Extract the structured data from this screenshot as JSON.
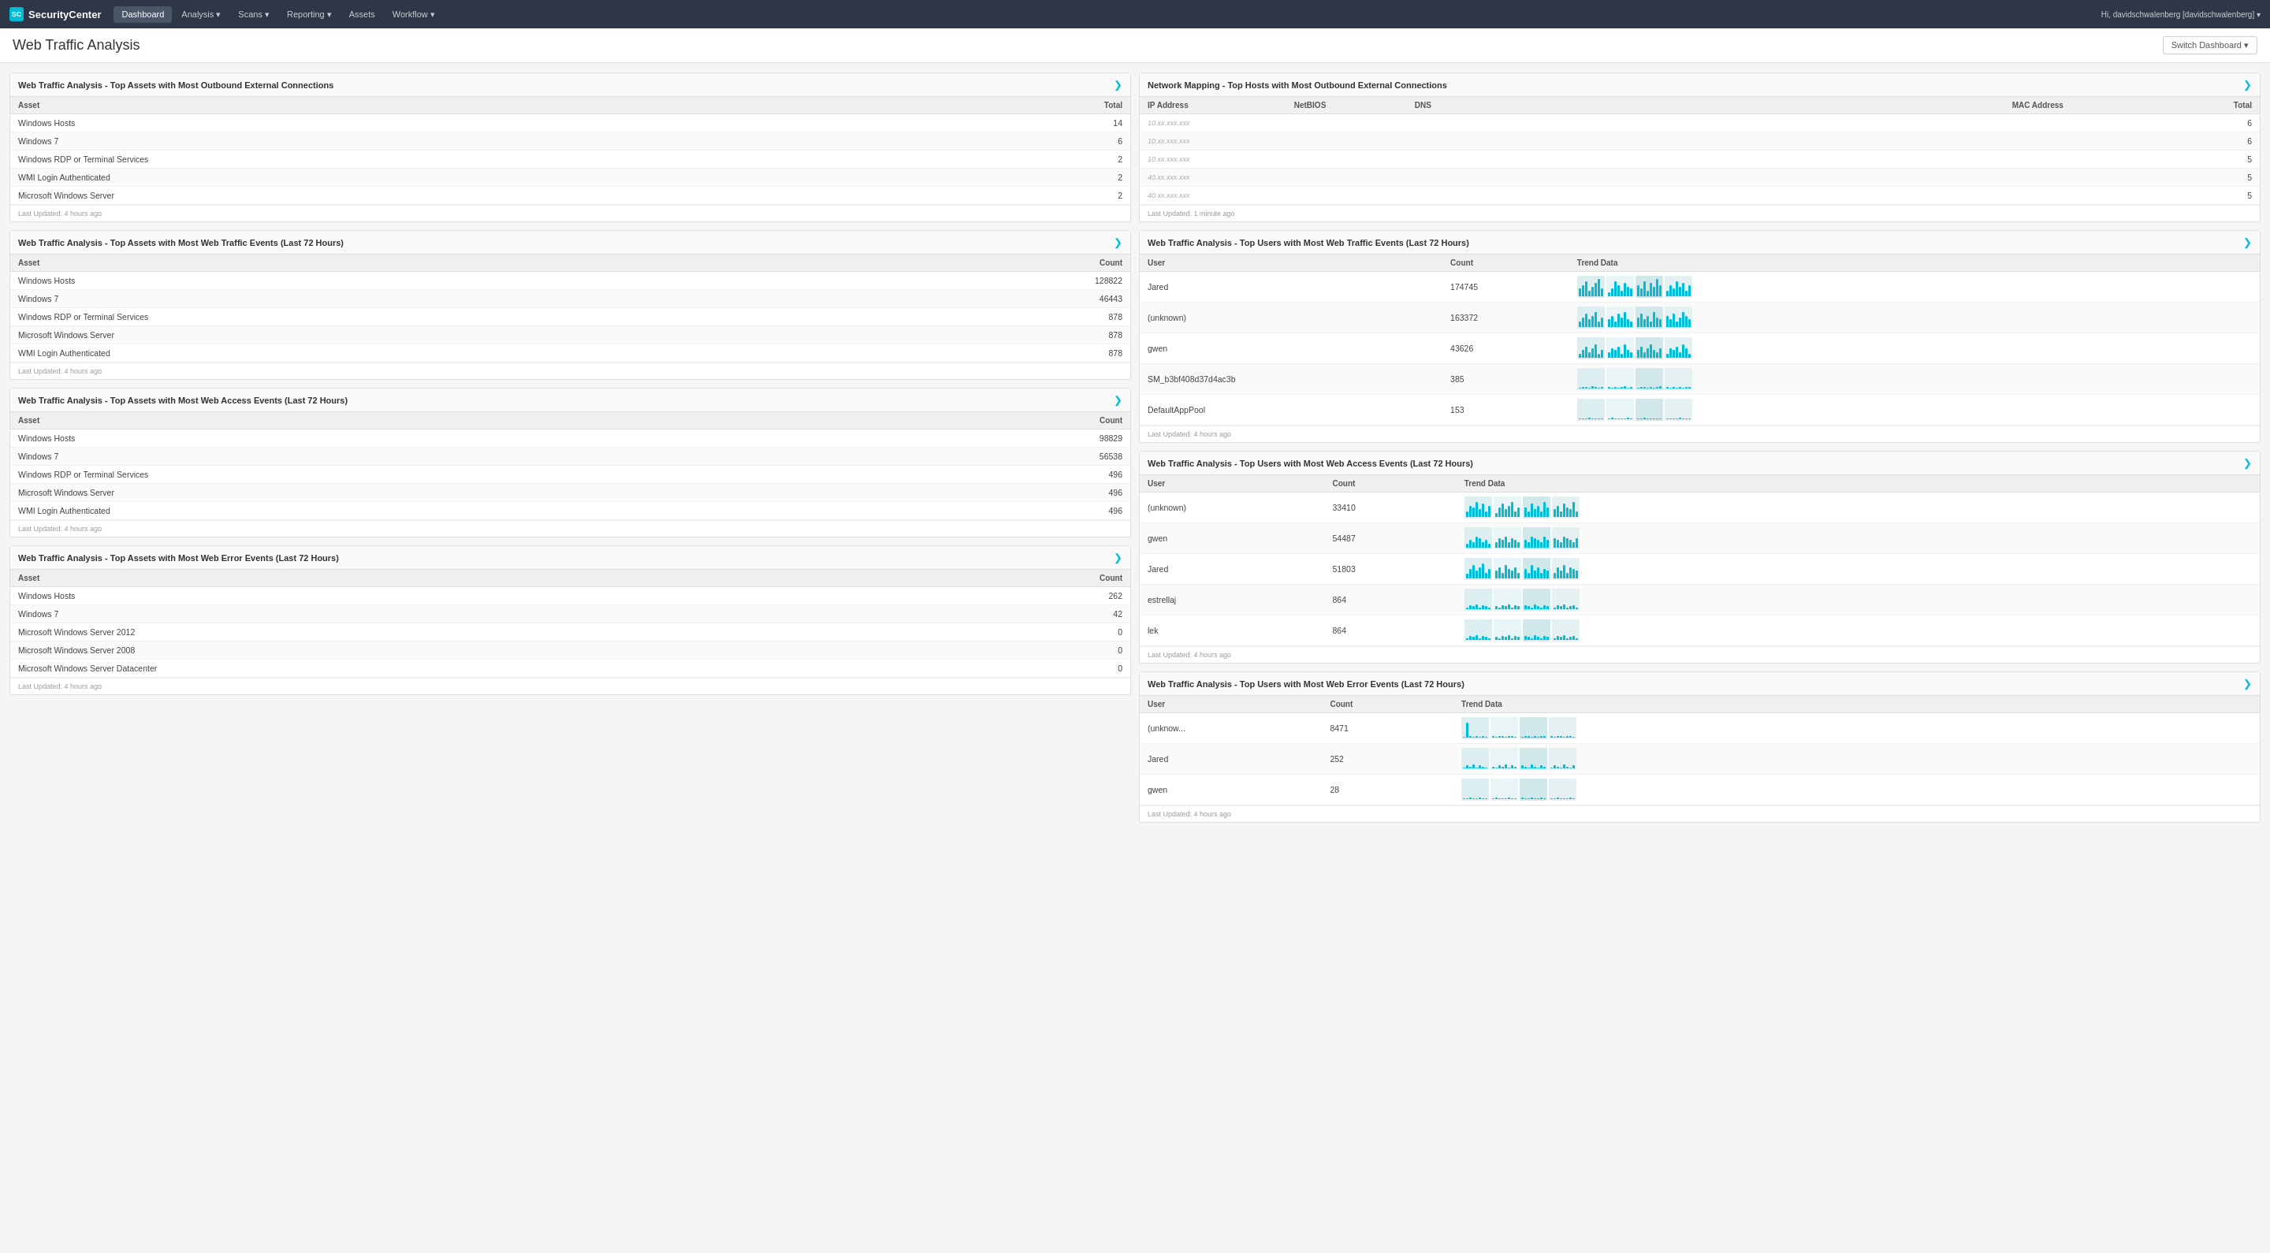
{
  "navbar": {
    "brand": "SecurityCenter",
    "logo_text": "SC",
    "links": [
      {
        "label": "Dashboard",
        "active": true,
        "has_arrow": false
      },
      {
        "label": "Analysis",
        "active": false,
        "has_arrow": true
      },
      {
        "label": "Scans",
        "active": false,
        "has_arrow": true
      },
      {
        "label": "Reporting",
        "active": false,
        "has_arrow": true
      },
      {
        "label": "Assets",
        "active": false,
        "has_arrow": false
      },
      {
        "label": "Workflow",
        "active": false,
        "has_arrow": true
      }
    ],
    "user": "Hi, davidschwalenberg [davidschwalenberg] ▾"
  },
  "page": {
    "title": "Web Traffic Analysis",
    "switch_dashboard_label": "Switch Dashboard ▾"
  },
  "panels": {
    "top_outbound": {
      "title": "Web Traffic Analysis - Top Assets with Most Outbound External Connections",
      "columns": [
        "Asset",
        "Total"
      ],
      "rows": [
        {
          "asset": "Windows Hosts",
          "value": "14"
        },
        {
          "asset": "Windows 7",
          "value": "6"
        },
        {
          "asset": "Windows RDP or Terminal Services",
          "value": "2"
        },
        {
          "asset": "WMI Login Authenticated",
          "value": "2"
        },
        {
          "asset": "Microsoft Windows Server",
          "value": "2"
        }
      ],
      "footer": "Last Updated: 4 hours ago"
    },
    "top_web_traffic": {
      "title": "Web Traffic Analysis - Top Assets with Most Web Traffic Events (Last 72 Hours)",
      "columns": [
        "Asset",
        "Count"
      ],
      "rows": [
        {
          "asset": "Windows Hosts",
          "value": "128822"
        },
        {
          "asset": "Windows 7",
          "value": "46443"
        },
        {
          "asset": "Windows RDP or Terminal Services",
          "value": "878"
        },
        {
          "asset": "Microsoft Windows Server",
          "value": "878"
        },
        {
          "asset": "WMI Login Authenticated",
          "value": "878"
        }
      ],
      "footer": "Last Updated: 4 hours ago"
    },
    "top_web_access": {
      "title": "Web Traffic Analysis - Top Assets with Most Web Access Events (Last 72 Hours)",
      "columns": [
        "Asset",
        "Count"
      ],
      "rows": [
        {
          "asset": "Windows Hosts",
          "value": "98829"
        },
        {
          "asset": "Windows 7",
          "value": "56538"
        },
        {
          "asset": "Windows RDP or Terminal Services",
          "value": "496"
        },
        {
          "asset": "Microsoft Windows Server",
          "value": "496"
        },
        {
          "asset": "WMI Login Authenticated",
          "value": "496"
        }
      ],
      "footer": "Last Updated: 4 hours ago"
    },
    "top_web_error": {
      "title": "Web Traffic Analysis - Top Assets with Most Web Error Events (Last 72 Hours)",
      "columns": [
        "Asset",
        "Count"
      ],
      "rows": [
        {
          "asset": "Windows Hosts",
          "value": "262"
        },
        {
          "asset": "Windows 7",
          "value": "42"
        },
        {
          "asset": "Microsoft Windows Server 2012",
          "value": "0"
        },
        {
          "asset": "Microsoft Windows Server 2008",
          "value": "0"
        },
        {
          "asset": "Microsoft Windows Server Datacenter",
          "value": "0"
        }
      ],
      "footer": "Last Updated: 4 hours ago"
    },
    "network_mapping": {
      "title": "Network Mapping - Top Hosts with Most Outbound External Connections",
      "columns": [
        "IP Address",
        "NetBIOS",
        "DNS",
        "MAC Address",
        "Total"
      ],
      "rows": [
        {
          "ip": "10.xx.xxx.xxx",
          "netbios": "",
          "dns": "",
          "mac": "",
          "total": "6"
        },
        {
          "ip": "10.xx.xxx.xxx",
          "netbios": "",
          "dns": "",
          "mac": "",
          "total": "6"
        },
        {
          "ip": "10.xx.xxx.xxx",
          "netbios": "",
          "dns": "",
          "mac": "",
          "total": "5"
        },
        {
          "ip": "40.xx.xxx.xxx",
          "netbios": "",
          "dns": "",
          "mac": "",
          "total": "5"
        },
        {
          "ip": "40.xx.xxx.xxx",
          "netbios": "",
          "dns": "",
          "mac": "",
          "total": "5"
        }
      ],
      "footer": "Last Updated: 1 minute ago"
    },
    "user_web_traffic": {
      "title": "Web Traffic Analysis - Top Users with Most Web Traffic Events (Last 72 Hours)",
      "columns": [
        "User",
        "Count",
        "Trend Data"
      ],
      "rows": [
        {
          "user": "Jared",
          "count": "174745"
        },
        {
          "user": "(unknown)",
          "count": "163372"
        },
        {
          "user": "gwen",
          "count": "43626"
        },
        {
          "user": "SM_b3bf408d37d4ac3b",
          "count": "385"
        },
        {
          "user": "DefaultAppPool",
          "count": "153"
        }
      ],
      "footer": "Last Updated: 4 hours ago"
    },
    "user_web_access": {
      "title": "Web Traffic Analysis - Top Users with Most Web Access Events (Last 72 Hours)",
      "columns": [
        "User",
        "Count",
        "Trend Data"
      ],
      "rows": [
        {
          "user": "(unknown)",
          "count": "33410"
        },
        {
          "user": "gwen",
          "count": "54487"
        },
        {
          "user": "Jared",
          "count": "51803"
        },
        {
          "user": "estrellaj",
          "count": "864"
        },
        {
          "user": "lek",
          "count": "864"
        }
      ],
      "footer": "Last Updated: 4 hours ago"
    },
    "user_web_error": {
      "title": "Web Traffic Analysis - Top Users with Most Web Error Events (Last 72 Hours)",
      "columns": [
        "User",
        "Count",
        "Trend Data"
      ],
      "rows": [
        {
          "user": "(unknow...",
          "count": "8471"
        },
        {
          "user": "Jared",
          "count": "252"
        },
        {
          "user": "gwen",
          "count": "28"
        }
      ],
      "footer": "Last Updated: 4 hours ago"
    }
  }
}
